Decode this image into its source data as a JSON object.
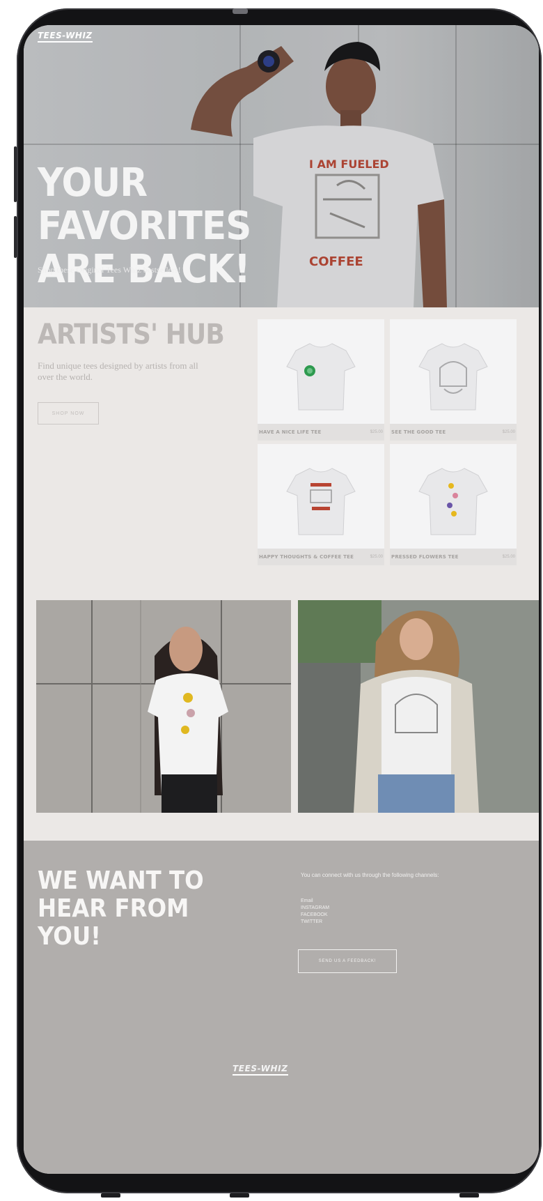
{
  "brand": {
    "logo_top": "TEES-WHIZ",
    "logo_bottom": "TEES-WHIZ"
  },
  "hero": {
    "title": "YOUR FAVORITES ARE BACK!",
    "subtitle": "Shop these Original Tees Whiz bestsellers!",
    "tee_print_top": "I AM FUELED",
    "tee_print_bottom": "COFFEE"
  },
  "hub": {
    "title": "ARTISTS' HUB",
    "description": "Find unique tees designed by artists from all over the world.",
    "button": "SHOP NOW",
    "products": [
      {
        "name": "HAVE A NICE LIFE TEE",
        "price": "$25.00"
      },
      {
        "name": "SEE THE GOOD TEE",
        "price": "$25.00"
      },
      {
        "name": "HAPPY THOUGHTS & COFFEE TEE",
        "price": "$25.00"
      },
      {
        "name": "PRESSED FLOWERS TEE",
        "price": "$25.00"
      }
    ]
  },
  "contact": {
    "title": "WE WANT TO HEAR FROM YOU!",
    "text": "You can connect with us through the following channels:",
    "links": [
      "Email",
      "INSTAGRAM",
      "FACEBOOK",
      "TWITTER"
    ],
    "button": "SEND US A FEEDBACK!"
  },
  "colors": {
    "hero_bg": "#c5c7c9",
    "hub_bg": "#ebe8e6",
    "contact_bg": "#b1aeac",
    "accent_text": "#f4f4f4"
  }
}
